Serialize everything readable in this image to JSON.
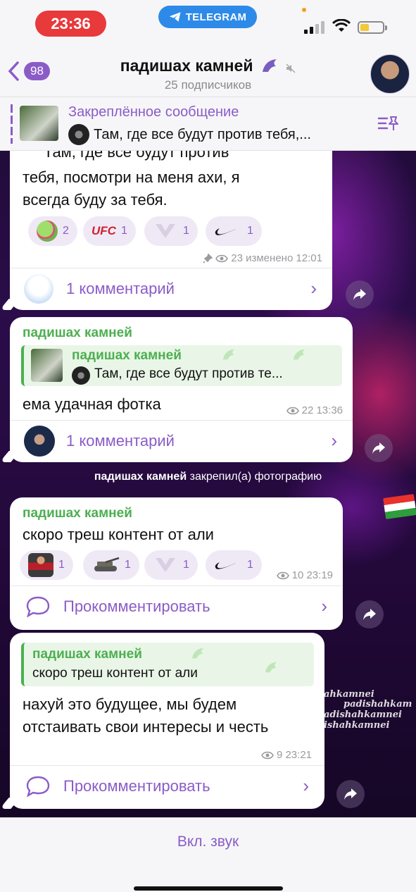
{
  "status_bar": {
    "time": "23:36",
    "app_pill": "TELEGRAM"
  },
  "header": {
    "back_count": "98",
    "title": "падишах камней",
    "subtitle": "25 подписчиков"
  },
  "pinned": {
    "title": "Закреплённое сообщение",
    "text": "Там, где все будут против тебя,..."
  },
  "msg1": {
    "text_partial": "Там, где все будут против",
    "text_lines": [
      "тебя, посмотри на меня ахи, я",
      "всегда буду за тебя."
    ],
    "reactions": [
      {
        "icon": "frog-sticker",
        "count": "2"
      },
      {
        "icon": "ufc-logo",
        "label": "UFC",
        "count": "1"
      },
      {
        "icon": "grey-emblem",
        "count": "1"
      },
      {
        "icon": "nike-swoosh",
        "count": "1"
      }
    ],
    "meta": "23 изменено 12:01",
    "comments": "1 комментарий"
  },
  "msg2": {
    "sender": "падишах камней",
    "reply_name": "падишах камней",
    "reply_text": "Там, где все будут против те...",
    "text": "ема удачная фотка",
    "meta": "22 13:36",
    "comments": "1 комментарий"
  },
  "service": {
    "name": "падишах камней",
    "text": "закрепил(а) фотографию"
  },
  "msg3": {
    "sender": "падишах камней",
    "text": "скоро треш контент от али",
    "reactions": [
      {
        "icon": "fighter-sticker",
        "count": "1"
      },
      {
        "icon": "tank-sticker",
        "count": "1"
      },
      {
        "icon": "grey-emblem",
        "count": "1"
      },
      {
        "icon": "nike-swoosh",
        "count": "1"
      }
    ],
    "meta": "10 23:19",
    "comment_cta": "Прокомментировать"
  },
  "msg4": {
    "reply_name": "падишах камней",
    "reply_text": "скоро треш контент от али",
    "text_lines": [
      "нахуй это будущее, мы будем",
      "отстаивать свои интересы и честь"
    ],
    "meta": "9 23:21",
    "comment_cta": "Прокомментировать"
  },
  "watermark": [
    "ahkamnei",
    "padishahkam",
    "adishahkamnei",
    "ishahkamnei"
  ],
  "bottom": {
    "sound_button": "Вкл. звук"
  },
  "colors": {
    "accent": "#8b5cc7",
    "sender_green": "#4caf50",
    "bubble": "#ffffff",
    "time_pill": "#e8393b",
    "telegram_pill": "#2d8ae8"
  }
}
